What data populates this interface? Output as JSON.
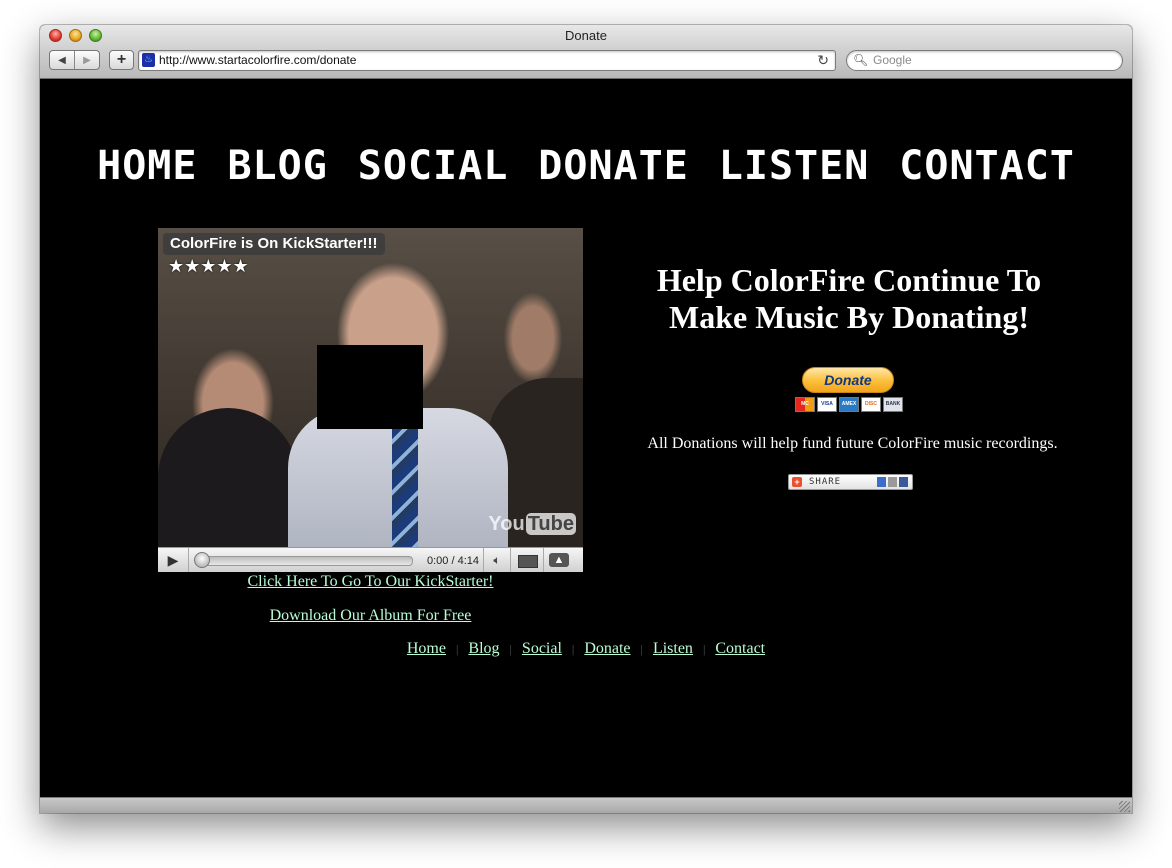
{
  "window": {
    "title": "Donate",
    "url": "http://www.startacolorfire.com/donate",
    "search_placeholder": "Google"
  },
  "top_nav": [
    "HOME",
    "BLOG",
    "SOCIAL",
    "DONATE",
    "LISTEN",
    "CONTACT"
  ],
  "video": {
    "title": "ColorFire is On KickStarter!!!",
    "rating_stars": 5,
    "stars_text": "★★★★★",
    "logo": {
      "you": "You",
      "tube": "Tube"
    },
    "time": "0:00 / 4:14",
    "progress": 0
  },
  "links": {
    "kickstarter": "Click Here To Go To Our KickStarter!",
    "album": "Download Our Album For Free"
  },
  "donate_section": {
    "headline": "Help ColorFire Continue To Make Music By Donating!",
    "button_label": "Donate",
    "cards": [
      "MC",
      "VISA",
      "AMEX",
      "DISC",
      "BANK"
    ],
    "note": "All Donations will help fund future ColorFire music recordings.",
    "share_label": "SHARE"
  },
  "footer_nav": [
    "Home",
    "Blog",
    "Social",
    "Donate",
    "Listen",
    "Contact"
  ],
  "footer_separator": "|",
  "colors": {
    "page_background": "#000000",
    "link": "#b8fdd5",
    "text": "#ffffff",
    "paypal_button": "#fbbf39"
  },
  "icons": {
    "back": "triangle-left-icon",
    "forward": "triangle-right-icon",
    "add": "plus-icon",
    "reload": "reload-icon",
    "search": "magnifier-icon",
    "play": "play-icon",
    "volume": "speaker-icon"
  }
}
